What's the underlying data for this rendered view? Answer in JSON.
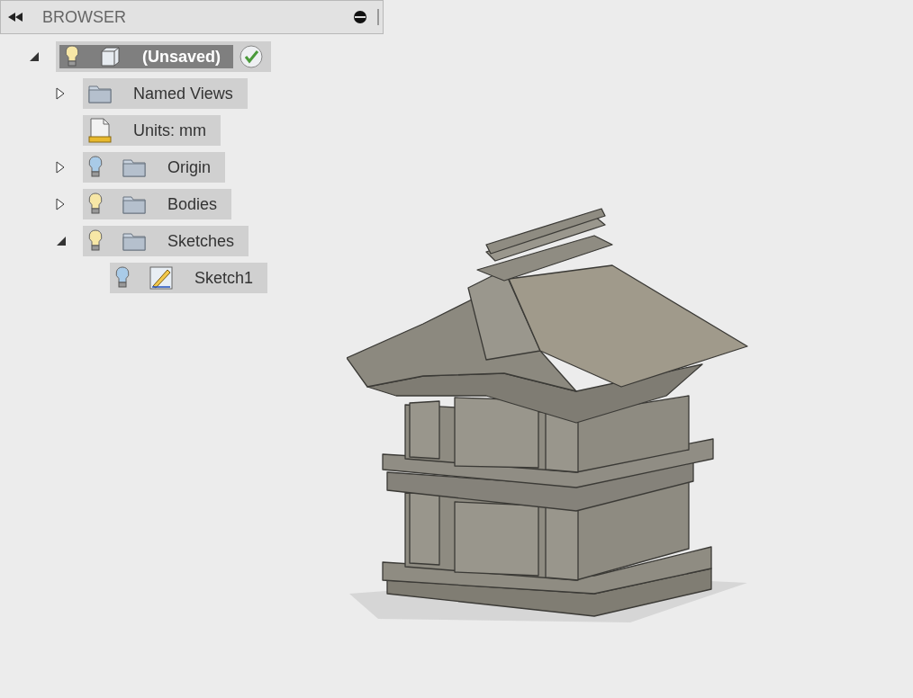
{
  "panel": {
    "title": "BROWSER"
  },
  "tree": [
    {
      "label": "(Unsaved)",
      "kind": "component",
      "color": "#f7e7a6",
      "expanded": true,
      "selected": true,
      "children": [
        {
          "label": "Named Views",
          "kind": "folder",
          "expanded": false,
          "selected": false
        },
        {
          "label": "Units: mm",
          "kind": "units",
          "selected": false
        },
        {
          "label": "Origin",
          "kind": "folder",
          "color": "#a9cbe8",
          "expanded": false,
          "selected": false
        },
        {
          "label": "Bodies",
          "kind": "folder",
          "color": "#f7e7a6",
          "expanded": false,
          "selected": false
        },
        {
          "label": "Sketches",
          "kind": "folder",
          "color": "#f7e7a6",
          "expanded": true,
          "selected": false,
          "children": [
            {
              "label": "Sketch1",
              "kind": "sketch",
              "color": "#a9cbe8",
              "selected": false
            }
          ]
        }
      ]
    }
  ]
}
